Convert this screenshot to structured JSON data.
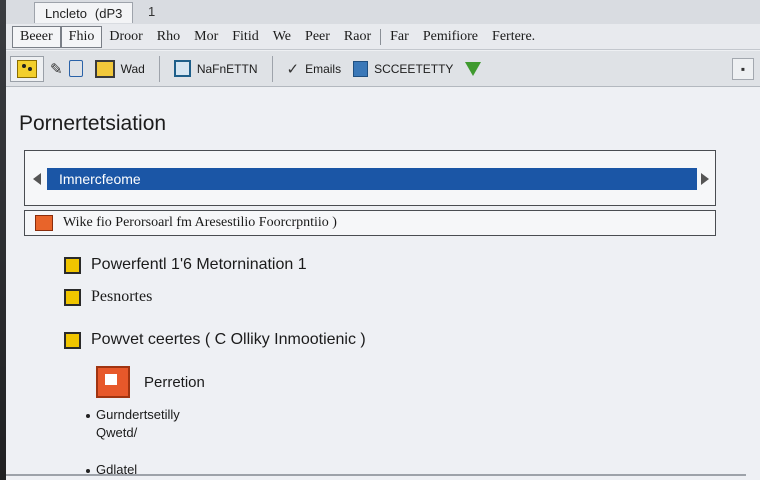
{
  "window": {
    "title": "Lncleto",
    "title_extra": "(dP3",
    "title_close": "1"
  },
  "menu": {
    "items": [
      "Beeer",
      "Fhio",
      "Droor",
      "Rho",
      "Mor",
      "Fitid",
      "We",
      "Peer",
      "Raor",
      "Far",
      "Pemifiore",
      "Fertere."
    ]
  },
  "toolbar": {
    "btn_wad_label": "Wad",
    "btn_nafnetth_label": "NaFnETTN",
    "btn_emails_label": "Emails",
    "btn_scc_label": "SCCEETETTY",
    "icons": [
      "face-icon",
      "pencil-icon",
      "document-icon",
      "box-icon",
      "square-icon",
      "checkmark-icon",
      "blue-square-icon",
      "green-arrow-icon",
      "small-box-icon"
    ]
  },
  "content": {
    "page_title": "Pornertetsiation",
    "combo_selected": "Imnercfeome",
    "link_row": "Wike fio Perorsoarl fm Aresestilio Foorcrpntiio )",
    "checkboxes": [
      {
        "label": "Powerfentl 1'6 Metornination 1"
      },
      {
        "label": "Pesnortes"
      },
      {
        "label": "Powvet ceertes ( C Olliky Inmootienic )"
      }
    ],
    "sub_item": "Perretion",
    "bullets": [
      {
        "line1": "Gurndertsetilly",
        "line2": "Qwetd/"
      },
      {
        "line1": "Gdlatel",
        "line2": ""
      }
    ]
  },
  "colors": {
    "accent_blue": "#1b56a6",
    "checkbox_yellow": "#f0c500",
    "orange_icon": "#e7582a"
  }
}
